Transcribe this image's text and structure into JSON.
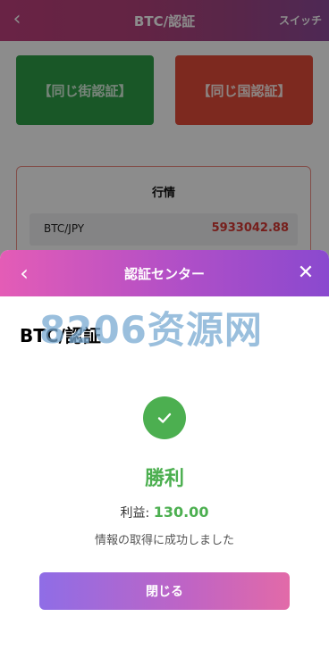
{
  "header": {
    "title": "BTC/認証",
    "switch_label": "スイッチ",
    "back_icon": "chevron-left-icon"
  },
  "verify_buttons": {
    "same_street": "【同じ街認証】",
    "same_country": "【同じ国認証】"
  },
  "market": {
    "title": "行情",
    "rows": [
      {
        "pair": "BTC/JPY",
        "price": "5933042.88"
      }
    ]
  },
  "modal": {
    "title": "認証センター",
    "subtitle": "BTC/認証",
    "watermark": "8206资源网",
    "result": "勝利",
    "profit_label": "利益:",
    "profit_value": "130.00",
    "message": "情報の取得に成功しました",
    "close_button": "閉じる",
    "icons": {
      "back": "chevron-left-icon",
      "close": "close-icon",
      "status": "check-icon"
    }
  },
  "colors": {
    "accent_gradient_start": "#e45cb6",
    "accent_gradient_end": "#8a49cf",
    "success": "#4caf50",
    "green_button": "#2e9e47",
    "red_button": "#e44b3a",
    "price": "#d83a34"
  }
}
